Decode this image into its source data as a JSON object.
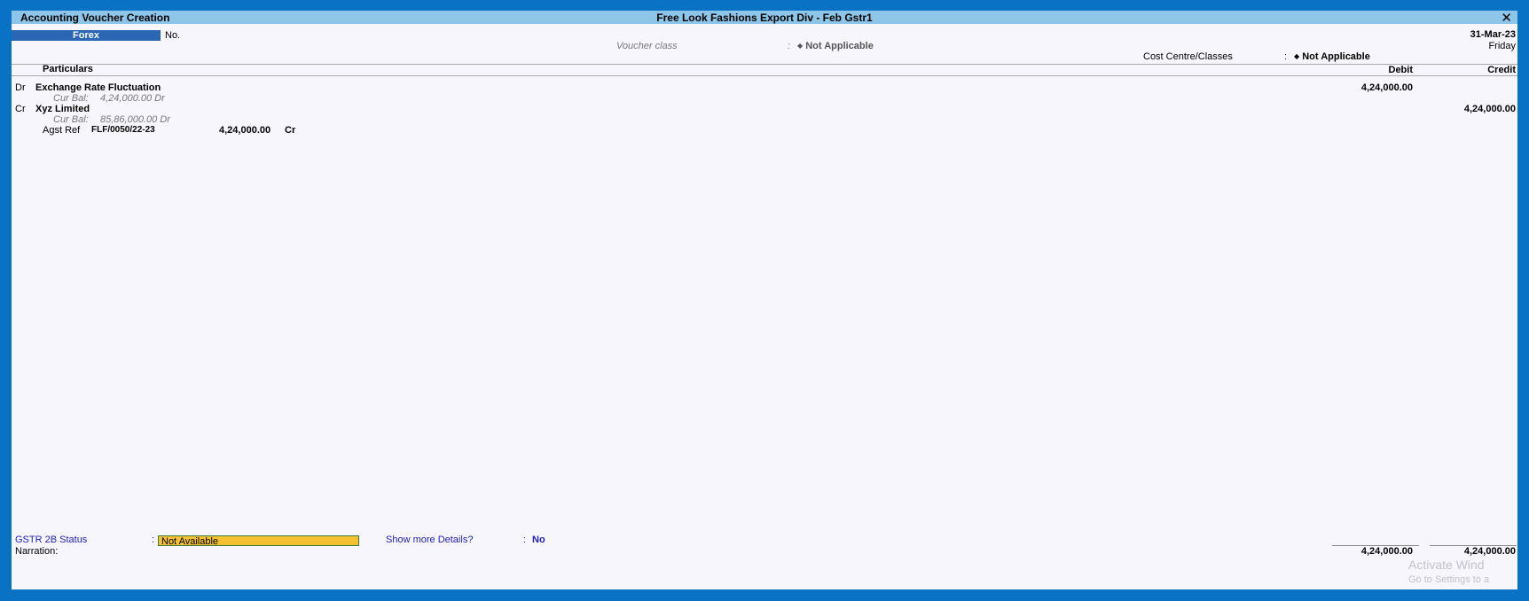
{
  "window": {
    "title": "Accounting Voucher Creation",
    "company": "Free Look Fashions  Export Div - Feb Gstr1",
    "close_icon": "close-icon"
  },
  "voucher": {
    "type": "Forex",
    "no_label": "No.",
    "date": "31-Mar-23",
    "day": "Friday",
    "class_label": "Voucher class",
    "class_sep": ":",
    "class_value": "Not Applicable",
    "cost_centre_label": "Cost Centre/Classes",
    "cost_centre_sep": ":",
    "cost_centre_value": "Not Applicable",
    "diamond": "◆"
  },
  "columns": {
    "particulars": "Particulars",
    "debit": "Debit",
    "credit": "Credit"
  },
  "entries": [
    {
      "drcr": "Dr",
      "ledger": "Exchange Rate Fluctuation",
      "cur_bal_label": "Cur Bal:",
      "cur_bal": "4,24,000.00 Dr",
      "debit": "4,24,000.00",
      "credit": ""
    },
    {
      "drcr": "Cr",
      "ledger": "Xyz Limited",
      "cur_bal_label": "Cur Bal:",
      "cur_bal": "85,86,000.00 Dr",
      "debit": "",
      "credit": "4,24,000.00",
      "bill": {
        "type": "Agst Ref",
        "ref": "FLF/0050/22-23",
        "amount": "4,24,000.00",
        "drcr": "Cr"
      }
    }
  ],
  "footer": {
    "gstr_label": "GSTR 2B Status",
    "gstr_sep": ":",
    "gstr_value": "Not Available",
    "show_more_label": "Show more Details?",
    "show_more_sep": ":",
    "show_more_value": "No",
    "narration_label": "Narration:",
    "total_debit": "4,24,000.00",
    "total_credit": "4,24,000.00"
  },
  "watermark": {
    "line1": "Activate Wind",
    "line2": "Go to Settings to a"
  }
}
